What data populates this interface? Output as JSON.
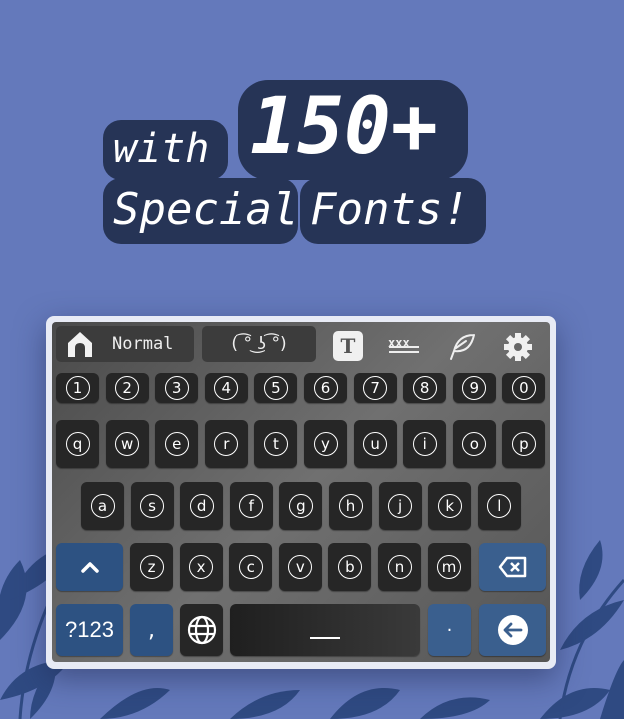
{
  "colors": {
    "background": "#6479bb",
    "leaf": "#2f4a82",
    "headline_outline": "#263456",
    "keyboard_frame": "#e8ebf5",
    "key": "#262626",
    "accent_key": "#2d5282"
  },
  "headline": {
    "line1_small": "with",
    "line1_big": "150+",
    "line2a": "Special",
    "line2b": "Fonts!"
  },
  "toolbar": {
    "home_icon": "home-icon",
    "font_name": "Normal",
    "kaomoji": "( ͡° ͜ʖ ͡°)",
    "font_icon_letter": "T",
    "strikethrough_icon": "strikethrough-text-icon",
    "feather_icon": "feather-icon",
    "settings_icon": "gear-icon"
  },
  "rows": {
    "numbers": [
      "1",
      "2",
      "3",
      "4",
      "5",
      "6",
      "7",
      "8",
      "9",
      "0"
    ],
    "row1": [
      "q",
      "w",
      "e",
      "r",
      "t",
      "y",
      "u",
      "i",
      "o",
      "p"
    ],
    "row2": [
      "a",
      "s",
      "d",
      "f",
      "g",
      "h",
      "j",
      "k",
      "l"
    ],
    "row3": [
      "z",
      "x",
      "c",
      "v",
      "b",
      "n",
      "m"
    ]
  },
  "bottom": {
    "symbols_label": "?123",
    "comma_label": ",",
    "space_label": "__",
    "period_label": "·"
  },
  "icons": {
    "shift": "shift-icon",
    "backspace": "backspace-icon",
    "globe": "globe-icon",
    "enter": "enter-icon"
  }
}
